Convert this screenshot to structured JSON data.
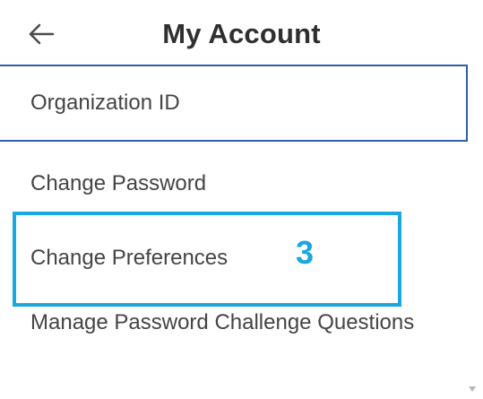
{
  "header": {
    "back_icon": "arrow-left-icon",
    "title": "My Account"
  },
  "menu": {
    "items": [
      {
        "label": "Organization ID"
      },
      {
        "label": "Change Password"
      },
      {
        "label": "Change Preferences"
      },
      {
        "label": "Manage Password Challenge Questions"
      }
    ]
  },
  "annotation": {
    "step": "3",
    "color": "#1aa7e0"
  },
  "colors": {
    "selected_border": "#2f5ea8",
    "text": "#444444"
  }
}
